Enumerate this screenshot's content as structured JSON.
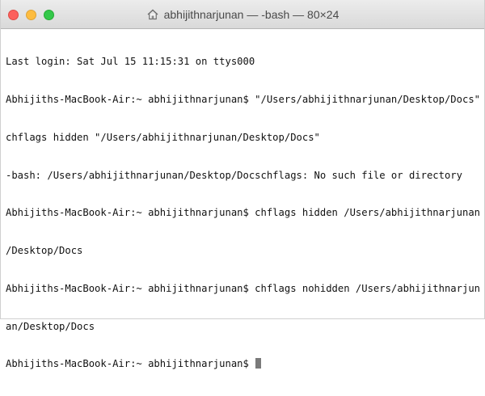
{
  "window": {
    "title": "abhijithnarjunan — -bash — 80×24"
  },
  "icons": {
    "close": "close-button",
    "minimize": "minimize-button",
    "zoom": "zoom-button",
    "title_icon": "home-icon"
  },
  "colors": {
    "close": "#fc605c",
    "minimize": "#fdbc40",
    "zoom": "#34c84a",
    "text": "#111111",
    "cursor": "#7a7a7a"
  },
  "terminal": {
    "lines": [
      "Last login: Sat Jul 15 11:15:31 on ttys000",
      "Abhijiths-MacBook-Air:~ abhijithnarjunan$ \"/Users/abhijithnarjunan/Desktop/Docs\"",
      "chflags hidden \"/Users/abhijithnarjunan/Desktop/Docs\"",
      "-bash: /Users/abhijithnarjunan/Desktop/Docschflags: No such file or directory",
      "Abhijiths-MacBook-Air:~ abhijithnarjunan$ chflags hidden /Users/abhijithnarjunan",
      "/Desktop/Docs",
      "Abhijiths-MacBook-Air:~ abhijithnarjunan$ chflags nohidden /Users/abhijithnarjun",
      "an/Desktop/Docs"
    ],
    "prompt": "Abhijiths-MacBook-Air:~ abhijithnarjunan$ "
  }
}
